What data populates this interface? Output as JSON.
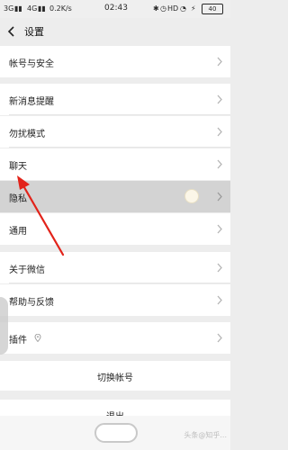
{
  "status_bar": {
    "network_left": "3G",
    "network_right": "4G",
    "speed": "0.2K/s",
    "time": "02:43",
    "right_text": "HD",
    "battery": "40"
  },
  "header": {
    "title": "设置"
  },
  "rows": {
    "account_security": "帐号与安全",
    "new_message_notify": "新消息提醒",
    "do_not_disturb": "勿扰模式",
    "chat": "聊天",
    "privacy": "隐私",
    "general": "通用",
    "about_wechat": "关于微信",
    "help_feedback": "帮助与反馈",
    "plugins": "插件"
  },
  "buttons": {
    "switch_account": "切换帐号",
    "logout": "退出"
  },
  "watermark": "头条@知乎..."
}
